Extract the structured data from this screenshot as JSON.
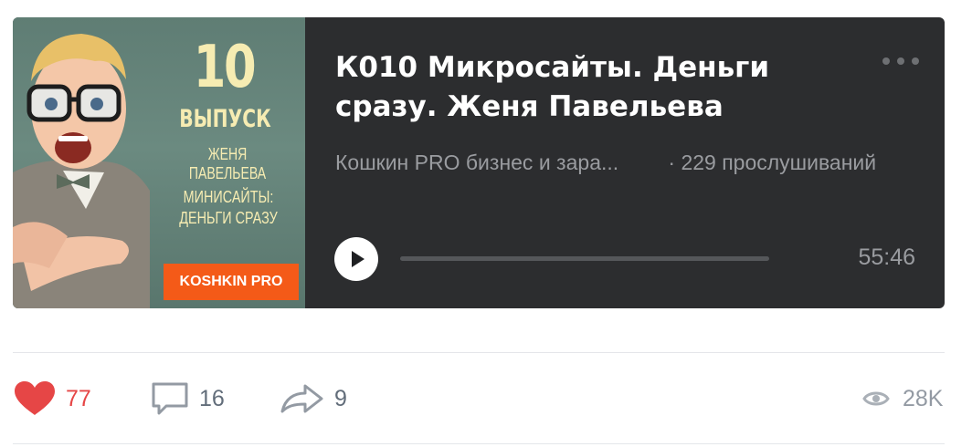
{
  "audio": {
    "cover": {
      "number": "10",
      "issue_label": "ВЫПУСК",
      "author": "ЖЕНЯ ПАВЕЛЬЕВА",
      "topic_line1": "МИНИСАЙТЫ:",
      "topic_line2": "ДЕНЬГИ СРАЗУ",
      "brand": "KOSHKIN PRO"
    },
    "title": "К010 Микросайты. Деньги сразу. Женя Павельева",
    "artist": "Кошкин PRO бизнес и зара...",
    "listens": "· 229 прослушиваний",
    "duration": "55:46",
    "progress": 0
  },
  "actions": {
    "likes": "77",
    "comments": "16",
    "shares": "9",
    "views": "28K"
  },
  "colors": {
    "player_bg": "#2c2d2f",
    "like": "#e64646",
    "brand_orange": "#f45a18",
    "cover_text": "#f6ecb2"
  },
  "icons": [
    "more-icon",
    "play-icon",
    "heart-icon",
    "comment-icon",
    "share-icon",
    "eye-icon"
  ]
}
